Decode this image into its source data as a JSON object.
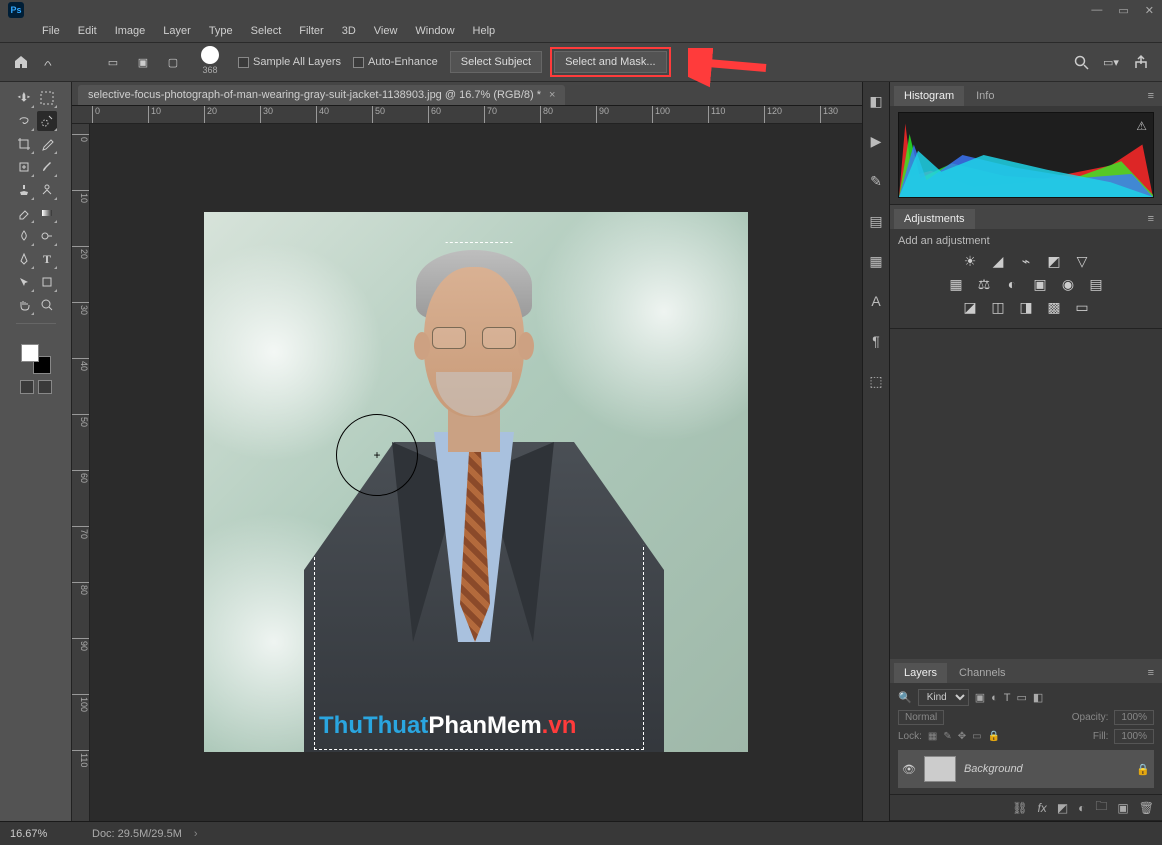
{
  "menu": {
    "items": [
      "File",
      "Edit",
      "Image",
      "Layer",
      "Type",
      "Select",
      "Filter",
      "3D",
      "View",
      "Window",
      "Help"
    ]
  },
  "options": {
    "brush_size": "368",
    "sample_all_layers": "Sample All Layers",
    "auto_enhance": "Auto-Enhance",
    "select_subject": "Select Subject",
    "select_and_mask": "Select and Mask..."
  },
  "document": {
    "tab_title": "selective-focus-photograph-of-man-wearing-gray-suit-jacket-1138903.jpg @ 16.7% (RGB/8) *",
    "zoom": "16.67%",
    "doc_info": "Doc: 29.5M/29.5M"
  },
  "ruler_h": [
    "0",
    "10",
    "20",
    "30",
    "40",
    "50",
    "60",
    "70",
    "80",
    "90",
    "100",
    "110",
    "120",
    "130"
  ],
  "ruler_v": [
    "0",
    "10",
    "20",
    "30",
    "40",
    "50",
    "60",
    "70",
    "80",
    "90",
    "100",
    "110"
  ],
  "watermark": {
    "p1": "ThuThuat",
    "p2": "PhanMem",
    "p3": ".vn"
  },
  "panels": {
    "histogram": {
      "tabs": [
        "Histogram",
        "Info"
      ],
      "active": 0
    },
    "adjustments": {
      "title": "Adjustments",
      "hint": "Add an adjustment",
      "row1": [
        "brightness",
        "levels",
        "curves",
        "exposure",
        "vibrance"
      ],
      "row2": [
        "hue",
        "balance",
        "bw",
        "photo-filter",
        "channel-mixer",
        "lookup"
      ],
      "row3": [
        "invert",
        "posterize",
        "threshold",
        "selective",
        "gradient-map"
      ]
    },
    "layers": {
      "tabs": [
        "Layers",
        "Channels"
      ],
      "active": 0,
      "kind": "Kind",
      "blend": "Normal",
      "opacity_label": "Opacity:",
      "opacity": "100%",
      "lock_label": "Lock:",
      "fill_label": "Fill:",
      "fill": "100%",
      "layer_name": "Background"
    }
  },
  "tools": [
    "move",
    "artboard",
    "marquee",
    "lasso",
    "crop",
    "eyedropper",
    "spot-heal",
    "brush",
    "clone",
    "history-brush",
    "eraser",
    "gradient",
    "blur",
    "dodge",
    "pen",
    "type",
    "path-select",
    "rectangle",
    "hand",
    "zoom"
  ]
}
